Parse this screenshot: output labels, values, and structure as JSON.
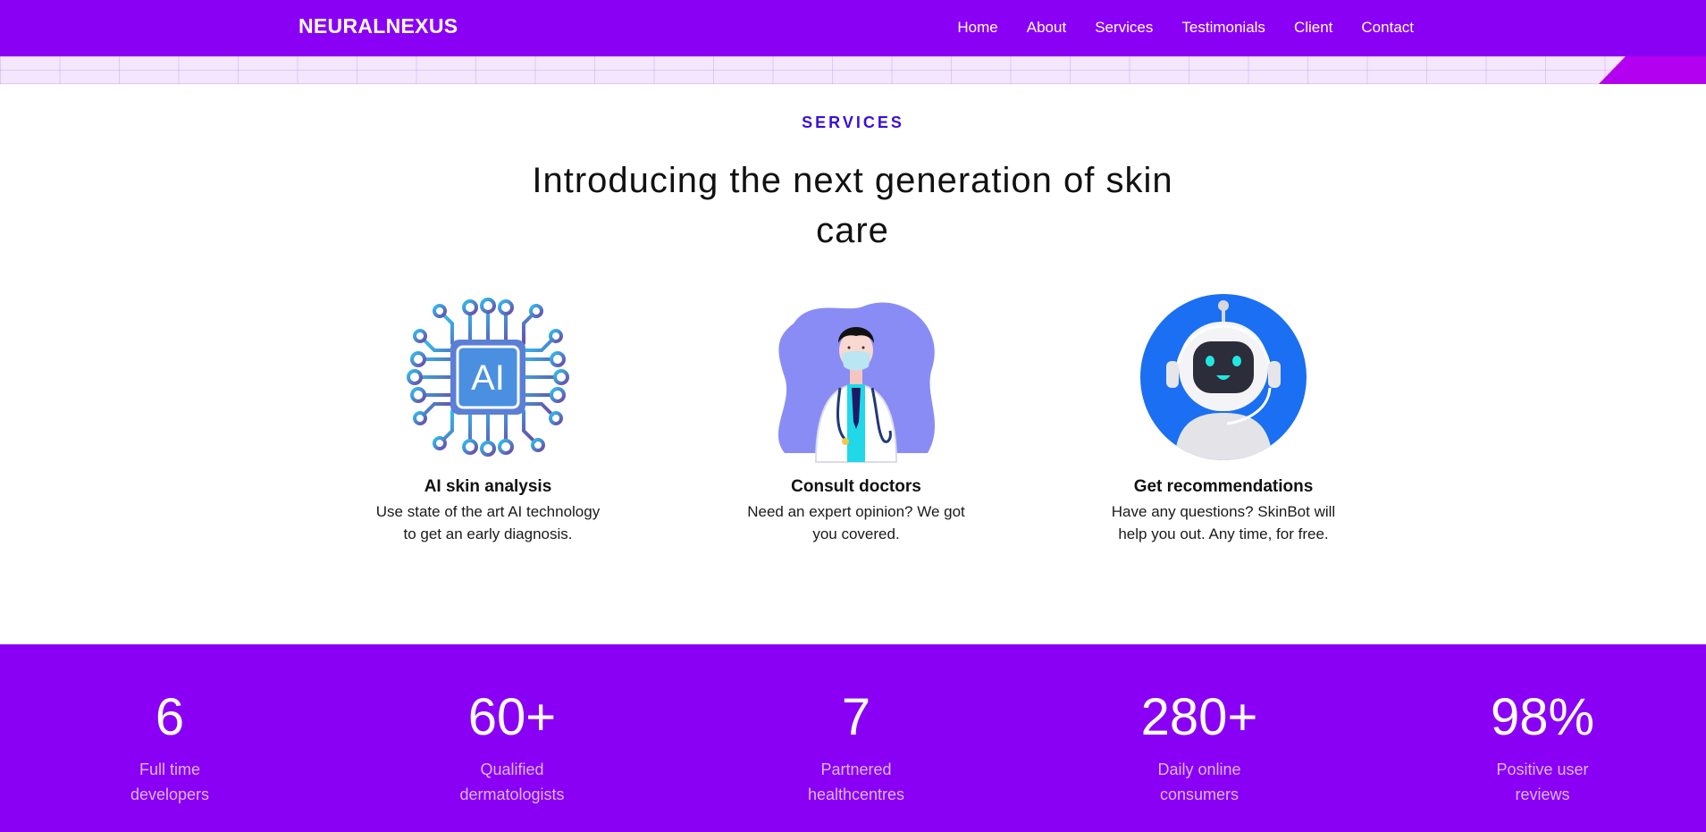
{
  "header": {
    "brand": "NEURALNEXUS",
    "nav": [
      "Home",
      "About",
      "Services",
      "Testimonials",
      "Client",
      "Contact"
    ]
  },
  "services": {
    "eyebrow": "SERVICES",
    "headline": "Introducing the next generation of skin care",
    "cards": [
      {
        "icon": "ai-chip-icon",
        "title": "AI skin analysis",
        "desc": "Use state of the art AI technology to get an early diagnosis."
      },
      {
        "icon": "doctor-icon",
        "title": "Consult doctors",
        "desc": "Need an expert opinion? We got you covered."
      },
      {
        "icon": "robot-icon",
        "title": "Get recommendations",
        "desc": "Have any questions? SkinBot will help you out. Any time, for free."
      }
    ]
  },
  "stats": [
    {
      "value": "6",
      "label": "Full time developers"
    },
    {
      "value": "60+",
      "label": "Qualified dermatologists"
    },
    {
      "value": "7",
      "label": "Partnered healthcentres"
    },
    {
      "value": "280+",
      "label": "Daily online consumers"
    },
    {
      "value": "98%",
      "label": "Positive user reviews"
    }
  ],
  "colors": {
    "brand": "#8a00f5",
    "accent": "#3a10d8",
    "corner": "#b400f0"
  }
}
